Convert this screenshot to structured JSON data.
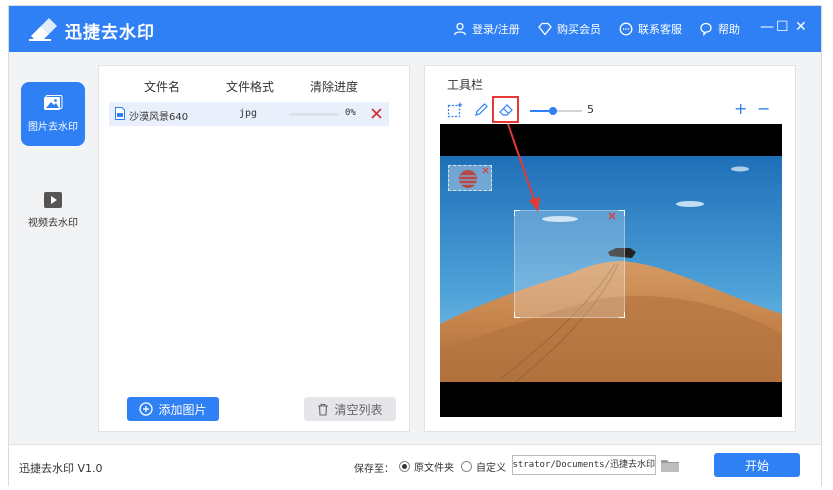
{
  "app": {
    "title": "迅捷去水印",
    "version": "迅捷去水印 V1.0"
  },
  "titlebar": {
    "login": "登录/注册",
    "buy": "购买会员",
    "service": "联系客服",
    "help": "帮助",
    "minimize": "—",
    "maximize": "☐",
    "close": "✕"
  },
  "nav": {
    "image_label": "图片去水印",
    "video_label": "视频去水印"
  },
  "filelist": {
    "col_name": "文件名",
    "col_format": "文件格式",
    "col_progress": "清除进度",
    "rows": [
      {
        "name": "沙漠风景640",
        "format": "jpg",
        "progress": "0%",
        "progress_value": 0
      }
    ],
    "add_button": "添加图片",
    "clear_button": "清空列表"
  },
  "toolbar": {
    "label": "工具栏",
    "brush_size": "5",
    "zoom_in": "+",
    "zoom_out": "−",
    "selected_tool": "eraser",
    "tools": [
      "rect-select-icon",
      "pen-icon",
      "eraser-icon"
    ]
  },
  "status": {
    "save_to": "保存至：",
    "option_original": "原文件夹",
    "option_custom": "自定义",
    "selected_option": "original",
    "path": "istrator/Documents/迅捷去水印",
    "start_button": "开始"
  },
  "colors": {
    "accent": "#2f80f5",
    "highlight_red": "#e53935"
  }
}
